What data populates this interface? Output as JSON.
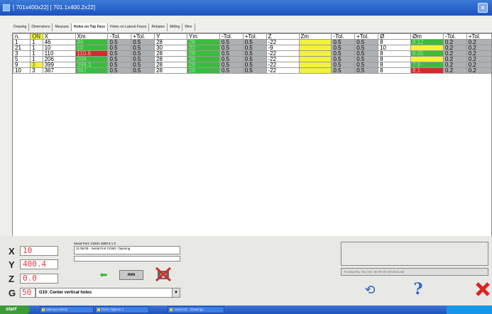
{
  "window": {
    "title": "[ 701x400x22] [ 701.1x400.2x22]"
  },
  "tabs": [
    "Drawing",
    "Dimensions",
    "Measure",
    "Holes on Top Face",
    "Holes on Lateral Faces",
    "Rebates",
    "Milling",
    "Wire"
  ],
  "active_tab": 3,
  "table": {
    "columns": [
      "n.",
      "ON",
      "X",
      "Xm",
      "-Tol.",
      "+Tol.",
      "Y",
      "Ym",
      "-Tol.",
      "+Tol.",
      "Z",
      "Zm",
      "-Tol.",
      "+Tol.",
      "Ø",
      "Øm",
      "-Tol.",
      "+Tol."
    ],
    "rows": [
      {
        "cells": [
          "1",
          "1",
          "46",
          "46",
          "0.5",
          "0.5",
          "28",
          "28",
          "0.5",
          "0.5",
          "-22",
          "",
          "0.5",
          "0.5",
          "8",
          "8.12",
          "0.2",
          "0.2"
        ],
        "colors": [
          "",
          "",
          "",
          "g",
          "",
          "",
          "",
          "g",
          "",
          "",
          "",
          "y",
          "",
          "",
          "",
          "g",
          "",
          ""
        ]
      },
      {
        "cells": [
          "21",
          "1",
          "10",
          "10",
          "0.5",
          "0.5",
          "30",
          "30",
          "0.5",
          "0.5",
          "-9",
          "",
          "0.5",
          "0.5",
          "10",
          "",
          "0.2",
          "0.2"
        ],
        "colors": [
          "",
          "",
          "",
          "g",
          "",
          "",
          "",
          "g",
          "",
          "",
          "",
          "y",
          "",
          "",
          "",
          "y",
          "",
          ""
        ]
      },
      {
        "cells": [
          "3",
          "1",
          "110",
          "110.6",
          "0.5",
          "0.5",
          "28",
          "28",
          "0.5",
          "0.5",
          "-22",
          "",
          "0.5",
          "0.5",
          "8",
          "8.05",
          "0.2",
          "0.2"
        ],
        "colors": [
          "",
          "",
          "",
          "r",
          "",
          "",
          "",
          "g",
          "",
          "",
          "",
          "y",
          "",
          "",
          "",
          "g",
          "",
          ""
        ]
      },
      {
        "cells": [
          "5",
          "1",
          "206",
          "206",
          "0.5",
          "0.5",
          "28",
          "28",
          "0.5",
          "0.5",
          "-22",
          "",
          "0.5",
          "0.5",
          "8",
          "",
          "0.2",
          "0.2"
        ],
        "colors": [
          "",
          "",
          "",
          "g",
          "",
          "",
          "",
          "g",
          "",
          "",
          "",
          "y",
          "",
          "",
          "",
          "y",
          "",
          ""
        ]
      },
      {
        "cells": [
          "9",
          "3",
          "399",
          "399.1",
          "0.5",
          "0.5",
          "28",
          "28",
          "0.5",
          "0.5",
          "-22",
          "",
          "0.5",
          "0.5",
          "8",
          "7.9",
          "0.2",
          "0.2"
        ],
        "colors": [
          "",
          "y",
          "",
          "g",
          "",
          "",
          "",
          "g",
          "",
          "",
          "",
          "y",
          "",
          "",
          "",
          "g",
          "",
          ""
        ]
      },
      {
        "cells": [
          "10",
          "3",
          "367",
          "367",
          "0.5",
          "0.5",
          "28",
          "28",
          "0.5",
          "0.5",
          "-22",
          "",
          "0.5",
          "0.5",
          "8",
          "8.1",
          "0.2",
          "0.2"
        ],
        "colors": [
          "",
          "",
          "",
          "g",
          "",
          "",
          "",
          "g",
          "",
          "",
          "",
          "y",
          "",
          "",
          "",
          "r",
          "",
          ""
        ]
      }
    ]
  },
  "axes": {
    "x": "10",
    "y": "400.4",
    "z": "0.0",
    "g": "50"
  },
  "axis_letters": {
    "x": "X",
    "y": "Y",
    "z": "Z",
    "g": "G"
  },
  "command": "G10: Center vertical holes",
  "serial": {
    "header": "Serial Port: COM1 4800 8 1 0",
    "log": "21:56:08 - Serial Port COM1: Opening"
  },
  "unit": "mm",
  "status_line": "Trustworthy #31 Dec 30 00 00 0004531.8d",
  "taskbar": {
    "start": "start",
    "tasks": [
      "Manual control",
      "DWG digitizer v",
      "AutoCAD - Drawing1"
    ]
  },
  "colors": {
    "ok": "#3dbb3d",
    "error": "#d22b2b",
    "pending": "#f2f23a",
    "tol": "#aeb1b4",
    "title_bar": "#1c52bf"
  }
}
